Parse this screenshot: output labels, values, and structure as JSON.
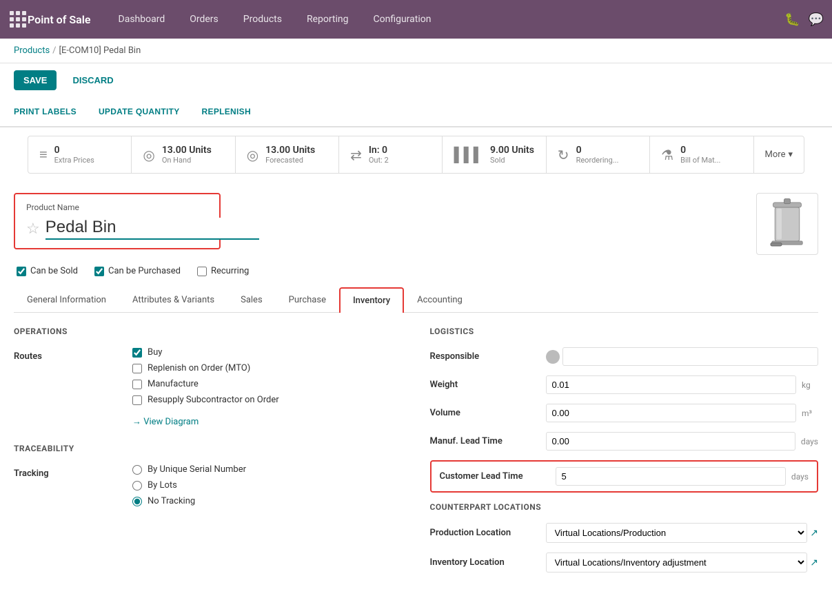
{
  "app": {
    "title": "Point of Sale",
    "nav_items": [
      "Dashboard",
      "Orders",
      "Products",
      "Reporting",
      "Configuration"
    ]
  },
  "breadcrumb": {
    "parent": "Products",
    "separator": "/",
    "current": "[E-COM10] Pedal Bin"
  },
  "action_bar": {
    "save_label": "SAVE",
    "discard_label": "DISCARD"
  },
  "sub_actions": [
    "PRINT LABELS",
    "UPDATE QUANTITY",
    "REPLENISH"
  ],
  "stats": [
    {
      "icon": "≡",
      "value": "0",
      "label": "Extra Prices"
    },
    {
      "icon": "◎",
      "value": "13.00 Units",
      "label": "On Hand"
    },
    {
      "icon": "◎",
      "value": "13.00 Units",
      "label": "Forecasted"
    },
    {
      "icon": "⇄",
      "value": "In: 0",
      "label": "Out: 2"
    },
    {
      "icon": "▌▌▌",
      "value": "9.00 Units",
      "label": "Sold"
    },
    {
      "icon": "↻",
      "value": "0",
      "label": "Reordering..."
    },
    {
      "icon": "⚗",
      "value": "0",
      "label": "Bill of Mat..."
    }
  ],
  "more_label": "More",
  "product": {
    "name_label": "Product Name",
    "name_value": "Pedal Bin",
    "star_char": "☆"
  },
  "checkboxes": [
    {
      "label": "Can be Sold",
      "checked": true
    },
    {
      "label": "Can be Purchased",
      "checked": true
    },
    {
      "label": "Recurring",
      "checked": false
    }
  ],
  "tabs": [
    {
      "label": "General Information",
      "active": false
    },
    {
      "label": "Attributes & Variants",
      "active": false
    },
    {
      "label": "Sales",
      "active": false
    },
    {
      "label": "Purchase",
      "active": false
    },
    {
      "label": "Inventory",
      "active": true
    },
    {
      "label": "Accounting",
      "active": false
    }
  ],
  "inventory_tab": {
    "operations": {
      "section_title": "Operations",
      "routes_label": "Routes",
      "routes": [
        {
          "label": "Buy",
          "checked": true
        },
        {
          "label": "Replenish on Order (MTO)",
          "checked": false
        },
        {
          "label": "Manufacture",
          "checked": false
        },
        {
          "label": "Resupply Subcontractor on Order",
          "checked": false
        }
      ],
      "view_diagram_label": "→ View Diagram"
    },
    "traceability": {
      "section_title": "Traceability",
      "tracking_label": "Tracking",
      "tracking_options": [
        {
          "label": "By Unique Serial Number",
          "selected": false
        },
        {
          "label": "By Lots",
          "selected": false
        },
        {
          "label": "No Tracking",
          "selected": true
        }
      ]
    },
    "logistics": {
      "section_title": "Logistics",
      "responsible_label": "Responsible",
      "responsible_value": "",
      "weight_label": "Weight",
      "weight_value": "0.01",
      "weight_unit": "kg",
      "volume_label": "Volume",
      "volume_value": "0.00",
      "volume_unit": "m³",
      "manuf_lead_time_label": "Manuf. Lead Time",
      "manuf_lead_time_value": "0.00",
      "manuf_lead_time_unit": "days",
      "customer_lead_time_label": "Customer Lead Time",
      "customer_lead_time_value": "5",
      "customer_lead_time_unit": "days"
    },
    "counterpart_locations": {
      "section_title": "Counterpart Locations",
      "production_location_label": "Production Location",
      "production_location_value": "Virtual Locations/Production",
      "inventory_location_label": "Inventory Location",
      "inventory_location_value": "Virtual Locations/Inventory adjustment"
    }
  }
}
